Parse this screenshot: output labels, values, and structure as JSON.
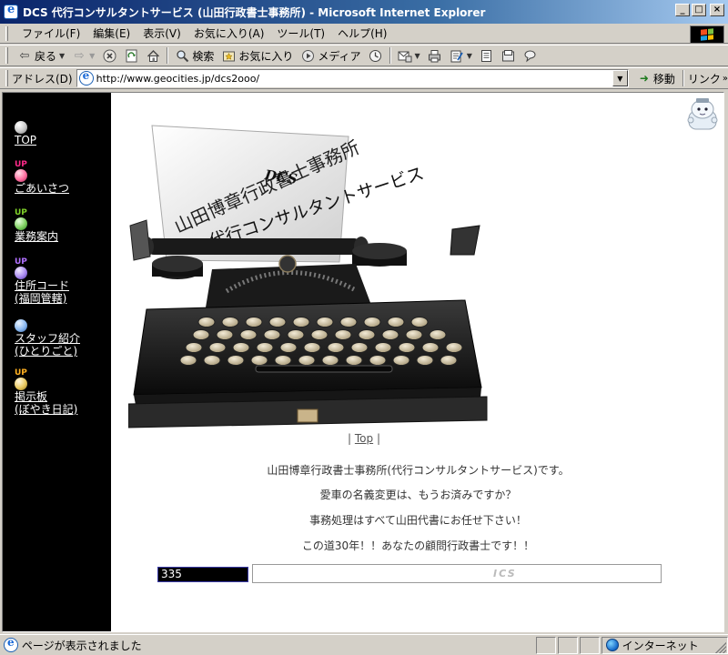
{
  "window": {
    "title": "DCS 代行コンサルタントサービス (山田行政書士事務所) - Microsoft Internet Explorer",
    "minimize": "_",
    "maximize": "□",
    "close": "×"
  },
  "menubar": {
    "items": [
      {
        "label": "ファイル(F)"
      },
      {
        "label": "編集(E)"
      },
      {
        "label": "表示(V)"
      },
      {
        "label": "お気に入り(A)"
      },
      {
        "label": "ツール(T)"
      },
      {
        "label": "ヘルプ(H)"
      }
    ]
  },
  "toolbar": {
    "back_label": "戻る",
    "search_label": "検索",
    "favorites_label": "お気に入り",
    "media_label": "メディア",
    "icons": [
      "back-arrow",
      "forward-arrow",
      "stop",
      "refresh",
      "home",
      "search",
      "favorites",
      "media",
      "history",
      "mail",
      "print",
      "edit",
      "discuss",
      "messenger"
    ]
  },
  "addressbar": {
    "label": "アドレス(D)",
    "url": "http://www.geocities.jp/dcs2ooo/",
    "go_label": "移動",
    "links_label": "リンク"
  },
  "sidebar": {
    "up_badge": "UP",
    "items": [
      {
        "label": "TOP",
        "label2": "",
        "ball_color": "#cfcfcf",
        "has_up": false
      },
      {
        "label": "ごあいさつ",
        "label2": "",
        "ball_color": "#ff6fa0",
        "has_up": true,
        "badge_color": "#ff2a8a"
      },
      {
        "label": "業務案内",
        "label2": "",
        "ball_color": "#7ed060",
        "has_up": true,
        "badge_color": "#7ed028"
      },
      {
        "label": "住所コード",
        "label2": "(福岡管轄)",
        "ball_color": "#a98af0",
        "has_up": true,
        "badge_color": "#b070ff"
      },
      {
        "label": "スタッフ紹介",
        "label2": "(ひとりごと)",
        "ball_color": "#8ab8f0",
        "has_up": false
      },
      {
        "label": "掲示板",
        "label2": "(ぼやき日記)",
        "ball_color": "#e8c860",
        "has_up": true,
        "badge_color": "#ffb020"
      }
    ]
  },
  "hero": {
    "paper_line1": "山田博章行政書士事務所",
    "paper_logo": "DCS",
    "paper_line2": "代行コンサルタントサービス"
  },
  "content": {
    "top_link": "Top",
    "top_prefix": "| ",
    "top_suffix": " |",
    "messages": [
      "山田博章行政書士事務所(代行コンサルタントサービス)です。",
      "愛車の名義変更は、もうお済みですか？",
      "事務処理はすべて山田代書にお任せ下さい！",
      "この道30年！！あなたの顧問行政書士です！！"
    ],
    "counter": "335",
    "banner_text": "ICS"
  },
  "statusbar": {
    "text": "ページが表示されました",
    "zone": "インターネット"
  }
}
